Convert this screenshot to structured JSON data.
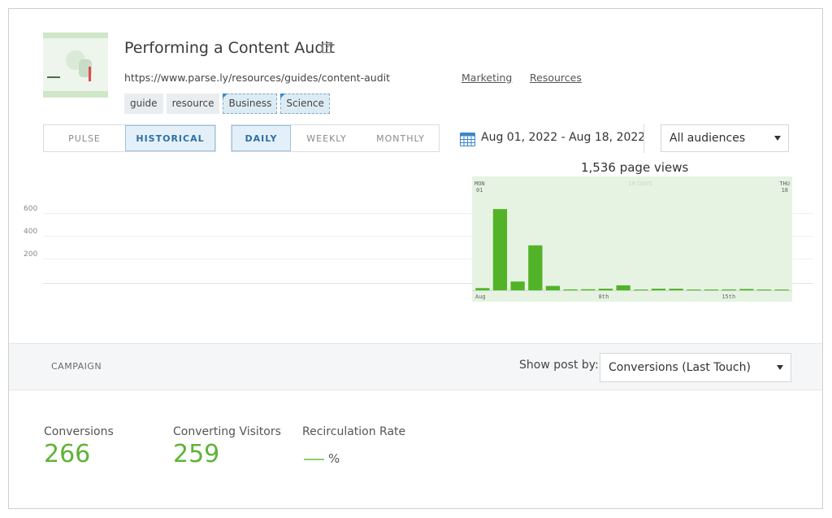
{
  "header": {
    "title": "Performing a Content Audit",
    "url": "https://www.parse.ly/resources/guides/content-audit",
    "categories": [
      "Marketing",
      "Resources"
    ],
    "tags": [
      {
        "label": "guide",
        "selected": false
      },
      {
        "label": "resource",
        "selected": false
      },
      {
        "label": "Business",
        "selected": true
      },
      {
        "label": "Science",
        "selected": true
      }
    ]
  },
  "controls": {
    "mode_tabs": [
      {
        "label": "PULSE",
        "active": false
      },
      {
        "label": "HISTORICAL",
        "active": true
      }
    ],
    "period_tabs": [
      {
        "label": "DAILY",
        "active": true
      },
      {
        "label": "WEEKLY",
        "active": false
      },
      {
        "label": "MONTHLY",
        "active": false
      }
    ],
    "date_range": "Aug 01, 2022 - Aug 18, 2022",
    "audience_select": "All audiences"
  },
  "chart_data": {
    "type": "bar",
    "title": "1,536 page views",
    "y_ticks": [
      "600",
      "400",
      "200"
    ],
    "corner_labels": {
      "start_day": "MON",
      "start_date": "01",
      "end_day": "THU",
      "end_date": "18",
      "center": "18 DAYS"
    },
    "x_tick_labels": [
      {
        "label": "Aug",
        "index": 0
      },
      {
        "label": "8th",
        "index": 7
      },
      {
        "label": "15th",
        "index": 14
      }
    ],
    "categories": [
      "1",
      "2",
      "3",
      "4",
      "5",
      "6",
      "7",
      "8",
      "9",
      "10",
      "11",
      "12",
      "13",
      "14",
      "15",
      "16",
      "17",
      "18"
    ],
    "values": [
      20,
      740,
      80,
      410,
      40,
      8,
      10,
      15,
      45,
      6,
      15,
      15,
      5,
      5,
      8,
      12,
      5,
      5
    ],
    "ylim": [
      0,
      800
    ],
    "color": "#52b329",
    "background": "#e6f3e2"
  },
  "campaign": {
    "label": "CAMPAIGN",
    "show_post_by_label": "Show post by:",
    "show_post_by_value": "Conversions (Last Touch)"
  },
  "metrics": [
    {
      "label": "Conversions",
      "value": "266"
    },
    {
      "label": "Converting Visitors",
      "value": "259"
    },
    {
      "label": "Recirculation Rate",
      "value": "%"
    }
  ],
  "colors": {
    "accent": "#5fb336",
    "active_tab": "#2d6fa3"
  }
}
